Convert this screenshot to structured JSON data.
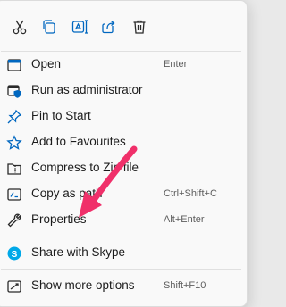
{
  "quick_actions": [
    {
      "name": "cut-icon"
    },
    {
      "name": "copy-icon"
    },
    {
      "name": "rename-icon"
    },
    {
      "name": "share-icon"
    },
    {
      "name": "delete-icon"
    }
  ],
  "menu": {
    "items": [
      {
        "label": "Open",
        "shortcut": "Enter",
        "icon": "open-window-icon"
      },
      {
        "label": "Run as administrator",
        "shortcut": "",
        "icon": "shield-icon"
      },
      {
        "label": "Pin to Start",
        "shortcut": "",
        "icon": "pin-icon"
      },
      {
        "label": "Add to Favourites",
        "shortcut": "",
        "icon": "star-icon"
      },
      {
        "label": "Compress to Zip file",
        "shortcut": "",
        "icon": "zip-folder-icon"
      },
      {
        "label": "Copy as path",
        "shortcut": "Ctrl+Shift+C",
        "icon": "copy-path-icon"
      },
      {
        "label": "Properties",
        "shortcut": "Alt+Enter",
        "icon": "wrench-icon"
      },
      {
        "label": "Share with Skype",
        "shortcut": "",
        "icon": "skype-icon"
      },
      {
        "label": "Show more options",
        "shortcut": "Shift+F10",
        "icon": "more-options-icon"
      }
    ]
  },
  "colors": {
    "accent": "#0067c0",
    "arrow": "#f0306a",
    "skype": "#00a8e8"
  }
}
